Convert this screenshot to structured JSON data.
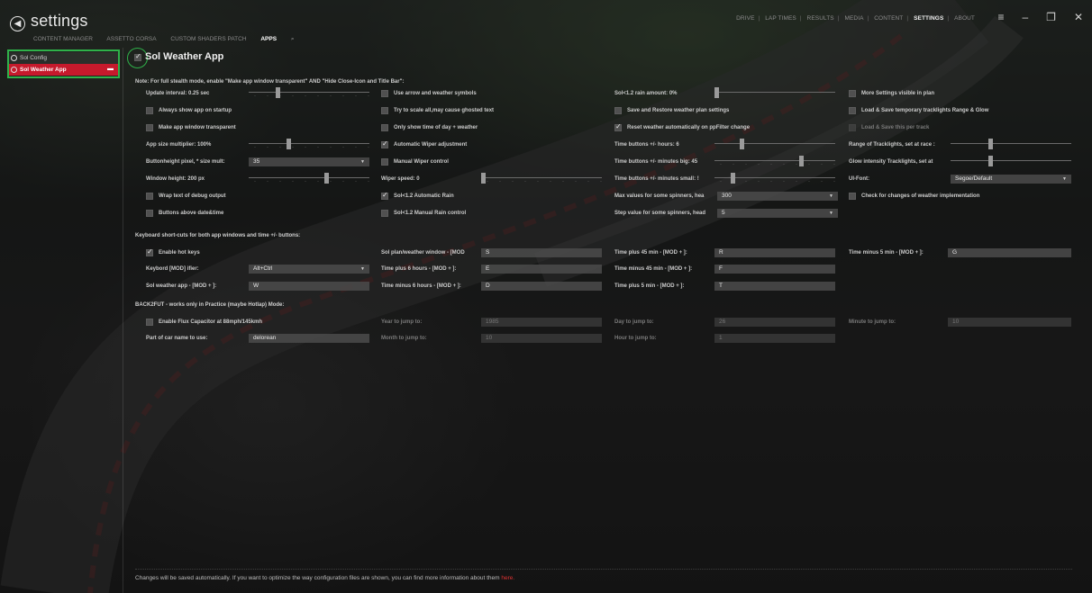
{
  "window": {
    "title": "settings",
    "topnav": [
      "DRIVE",
      "LAP TIMES",
      "RESULTS",
      "MEDIA",
      "CONTENT",
      "SETTINGS",
      "ABOUT"
    ],
    "topnav_active": "SETTINGS",
    "controls": {
      "menu": "≡",
      "minimize": "–",
      "maximize": "❐",
      "close": "✕"
    }
  },
  "subnav": {
    "items": [
      "CONTENT MANAGER",
      "ASSETTO CORSA",
      "CUSTOM SHADERS PATCH",
      "APPS"
    ],
    "active": "APPS"
  },
  "sidebar": {
    "items": [
      {
        "label": "Sol Config",
        "selected": false
      },
      {
        "label": "Sol Weather App",
        "selected": true
      }
    ]
  },
  "page": {
    "title": "Sol Weather App",
    "enabled": true,
    "note": "Note: For full stealth mode, enable \"Make app window transparent\" AND \"Hide Close-Icon and Title Bar\":"
  },
  "col1": {
    "update_interval": "Update interval: 0.25 sec",
    "always_show": "Always show app on startup",
    "transparent": "Make app window transparent",
    "size_mult": "App size multiplier: 100%",
    "button_height": "Buttonheight pixel, * size mult:",
    "button_height_value": "35",
    "window_height": "Window height: 200 px",
    "wrap_debug": "Wrap text of debug output",
    "buttons_above": "Buttons above date&time"
  },
  "col2": {
    "arrow_symbols": "Use arrow and weather symbols",
    "scale_all": "Try to scale all,may cause ghosted text",
    "only_time": "Only show time of day + weather",
    "auto_wiper": "Automatic Wiper adjustment",
    "manual_wiper": "Manual Wiper control",
    "wiper_speed": "Wiper speed: 0",
    "auto_rain": "Sol<1.2 Automatic Rain",
    "manual_rain": "Sol<1.2 Manual Rain control"
  },
  "col3": {
    "rain_amount": "Sol<1.2 rain amount: 0%",
    "save_restore": "Save and Restore weather plan settings",
    "reset_weather": "Reset weather automatically on ppFilter change",
    "time_hours": "Time buttons +/- hours: 6",
    "time_big": "Time buttons +/- minutes big: 45",
    "time_small": "Time buttons +/- minutes small: !",
    "max_values": "Max values for some spinners, hea",
    "max_values_value": "300",
    "step_value": "Step value for some spinners, head",
    "step_value_value": "5"
  },
  "col4": {
    "more_settings": "More Settings visible in plan",
    "load_save_tracklights": "Load & Save temporary tracklights Range & Glow",
    "load_save_track": "Load & Save this per track",
    "range_tracklights": "Range of Tracklights, set at race :",
    "glow_intensity": "Glow intensity Tracklights, set at",
    "ui_font": "UI-Font:",
    "ui_font_value": "Segoe/Default",
    "check_changes": "Check for changes of weather implementation"
  },
  "hotkeys": {
    "header": "Keyboard short-cuts for both app windows and time +/- buttons:",
    "enable": "Enable hot keys",
    "modifier_label": "Keybord [MOD] ifier:",
    "modifier_value": "Alt+Ctrl",
    "sol_app_label": "Sol weather app - [MOD + ]:",
    "sol_app_value": "W",
    "plan_window_label": "Sol plan/weather window - [MOD",
    "plan_window_value": "S",
    "plus6_label": "Time plus 6 hours - [MOD + ]:",
    "plus6_value": "E",
    "minus6_label": "Time minus 6 hours - [MOD + ]:",
    "minus6_value": "D",
    "plus45_label": "Time plus 45 min - [MOD + ]:",
    "plus45_value": "R",
    "minus45_label": "Time minus 45 min - [MOD + ]:",
    "minus45_value": "F",
    "plus5_label": "Time plus 5 min - [MOD + ]:",
    "plus5_value": "T",
    "minus5_label": "Time minus 5 min - [MOD + ]:",
    "minus5_value": "G"
  },
  "back2fut": {
    "header": "BACK2FUT - works only in Practice (maybe Hotlap) Mode:",
    "flux": "Enable Flux Capacitor at 88mph/145kmh",
    "car_name_label": "Part of car name to use:",
    "car_name_value": "delorean",
    "year_label": "Year to jump to:",
    "year_value": "1985",
    "month_label": "Month to jump to:",
    "month_value": "10",
    "day_label": "Day to jump to:",
    "day_value": "26",
    "hour_label": "Hour to jump to:",
    "hour_value": "1",
    "minute_label": "Minute to jump to:",
    "minute_value": "10"
  },
  "footer": {
    "text": "Changes will be saved automatically. If you want to optimize the way configuration files are shown, you can find more information about them",
    "link": "here."
  },
  "colors": {
    "accent_red": "#c61a2c",
    "highlight_green": "#2fb24a"
  }
}
